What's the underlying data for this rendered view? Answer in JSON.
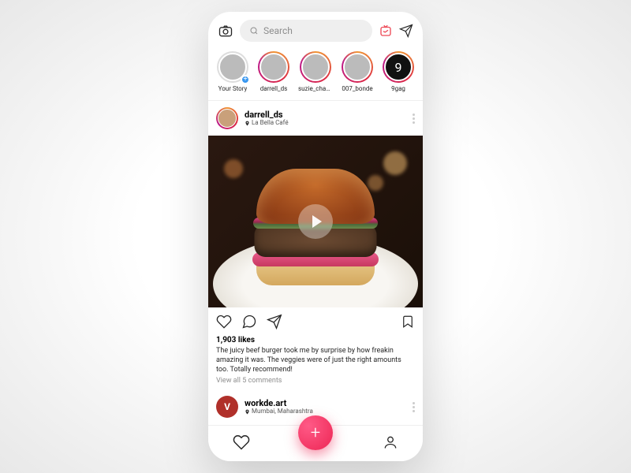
{
  "header": {
    "search_placeholder": "Search"
  },
  "stories": [
    {
      "label": "Your Story",
      "ring": "none",
      "own": true
    },
    {
      "label": "darrell_ds",
      "ring": "grad"
    },
    {
      "label": "suzie_chaan",
      "ring": "grad"
    },
    {
      "label": "007_bonde",
      "ring": "grad"
    },
    {
      "label": "9gag",
      "ring": "grad",
      "dark": true
    }
  ],
  "post": {
    "username": "darrell_ds",
    "location": "La Bella Café",
    "likes_text": "1,903 likes",
    "caption": "The juicy beef burger took me by surprise by how freakin amazing it was. The veggies were of just the right amounts too. Totally recommend!",
    "view_comments": "View all 5 comments"
  },
  "post2": {
    "username": "workde.art",
    "location": "Mumbai, Maharashtra"
  },
  "fab": {
    "label": "+"
  }
}
